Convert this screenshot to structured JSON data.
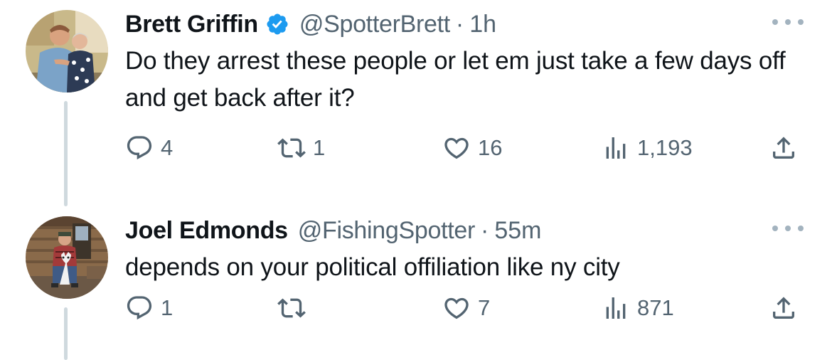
{
  "tweets": [
    {
      "name": "Brett Griffin",
      "verified": true,
      "handle": "@SpotterBrett",
      "separator": "·",
      "time": "1h",
      "text": "Do they arrest these people or let em just take a few days off and get back after it?",
      "replies": "4",
      "retweets": "1",
      "likes": "16",
      "views": "1,193"
    },
    {
      "name": "Joel Edmonds",
      "verified": false,
      "handle": "@FishingSpotter",
      "separator": "·",
      "time": "55m",
      "text": "depends on your political offiliation like ny city",
      "replies": "1",
      "retweets": "",
      "likes": "7",
      "views": "871"
    }
  ],
  "colors": {
    "text_primary": "#0f1419",
    "text_secondary": "#536471",
    "verified_badge": "#1d9bf0",
    "thread_line": "#cfd9de"
  }
}
